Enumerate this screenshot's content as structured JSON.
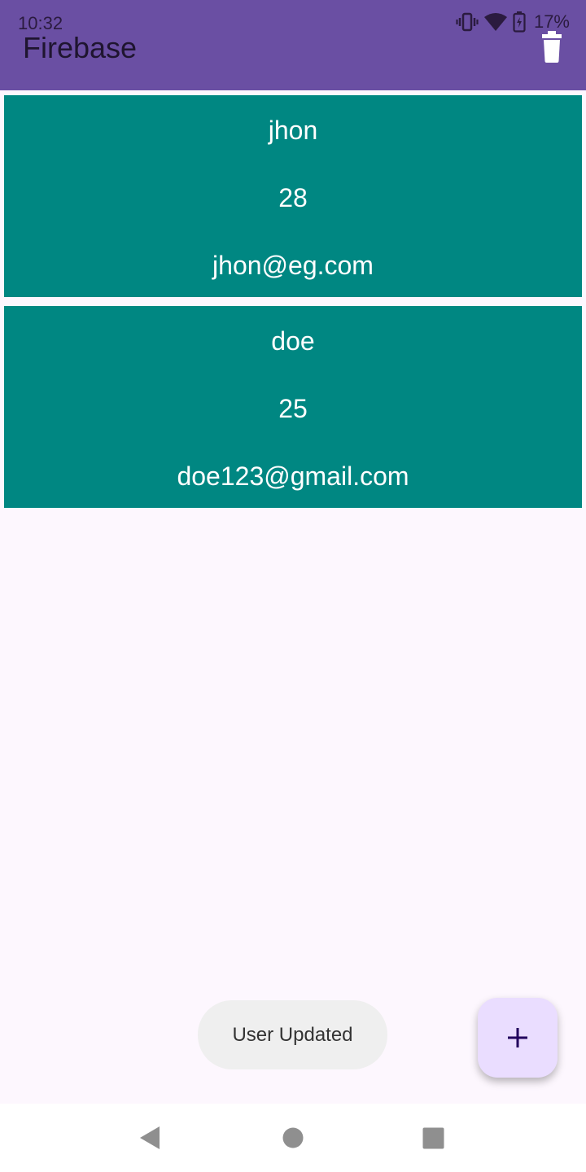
{
  "status_bar": {
    "time": "10:32",
    "battery": "17%",
    "icons": [
      "vibrate-icon",
      "wifi-icon",
      "battery-charging-icon"
    ]
  },
  "app_bar": {
    "title": "Firebase",
    "action_icon": "delete-icon",
    "color": "#6A4FA3"
  },
  "users": [
    {
      "name": "jhon",
      "age": "28",
      "email": "jhon@eg.com"
    },
    {
      "name": "doe",
      "age": "25",
      "email": "doe123@gmail.com"
    }
  ],
  "card_color": "#008782",
  "toast": {
    "message": "User Updated"
  },
  "fab": {
    "icon": "plus-icon",
    "color": "#EADDFF"
  },
  "nav_bar": {
    "icons": [
      "back-icon",
      "home-icon",
      "recents-icon"
    ]
  }
}
